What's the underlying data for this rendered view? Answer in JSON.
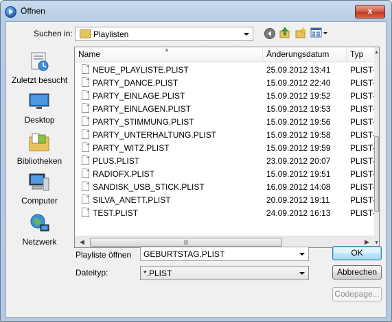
{
  "window": {
    "title": "Öffnen",
    "close_label": "x"
  },
  "toolbar": {
    "look_in_label": "Suchen in:",
    "look_in_value": "Playlisten",
    "icons": [
      "back-icon",
      "up-folder-icon",
      "new-folder-icon",
      "view-menu-icon"
    ]
  },
  "places": [
    {
      "label": "Zuletzt besucht",
      "icon": "recent-places-icon"
    },
    {
      "label": "Desktop",
      "icon": "desktop-icon"
    },
    {
      "label": "Bibliotheken",
      "icon": "libraries-icon"
    },
    {
      "label": "Computer",
      "icon": "computer-icon"
    },
    {
      "label": "Netzwerk",
      "icon": "network-icon"
    }
  ],
  "file_list": {
    "columns": [
      "Name",
      "Änderungsdatum",
      "Typ"
    ],
    "rows": [
      {
        "name": "NEUE_PLAYLISTE.PLIST",
        "date": "25.09.2012 13:41",
        "type": "PLIST-"
      },
      {
        "name": "PARTY_DANCE.PLIST",
        "date": "15.09.2012 22:40",
        "type": "PLIST-"
      },
      {
        "name": "PARTY_EINLAGE.PLIST",
        "date": "15.09.2012 19:52",
        "type": "PLIST-"
      },
      {
        "name": "PARTY_EINLAGEN.PLIST",
        "date": "15.09.2012 19:53",
        "type": "PLIST-"
      },
      {
        "name": "PARTY_STIMMUNG.PLIST",
        "date": "15.09.2012 19:56",
        "type": "PLIST-"
      },
      {
        "name": "PARTY_UNTERHALTUNG.PLIST",
        "date": "15.09.2012 19:58",
        "type": "PLIST-"
      },
      {
        "name": "PARTY_WITZ.PLIST",
        "date": "15.09.2012 19:59",
        "type": "PLIST-"
      },
      {
        "name": "PLUS.PLIST",
        "date": "23.09.2012 20:07",
        "type": "PLIST-"
      },
      {
        "name": "RADIOFX.PLIST",
        "date": "15.09.2012 19:51",
        "type": "PLIST-"
      },
      {
        "name": "SANDISK_USB_STICK.PLIST",
        "date": "16.09.2012 14:08",
        "type": "PLIST-"
      },
      {
        "name": "SILVA_ANETT.PLIST",
        "date": "20.09.2012 19:11",
        "type": "PLIST-"
      },
      {
        "name": "TEST.PLIST",
        "date": "24.09.2012 16:13",
        "type": "PLIST-"
      }
    ]
  },
  "form": {
    "filename_label": "Playliste öffnen",
    "filename_value": "GEBURTSTAG.PLIST",
    "filetype_label": "Dateityp:",
    "filetype_value": "*.PLIST"
  },
  "buttons": {
    "ok": "OK",
    "cancel": "Abbrechen",
    "codepage": "Codepage..."
  },
  "colors": {
    "title_gradient_top": "#c9dcee",
    "close_red": "#c0381f",
    "default_button_border": "#3c7fb1"
  }
}
